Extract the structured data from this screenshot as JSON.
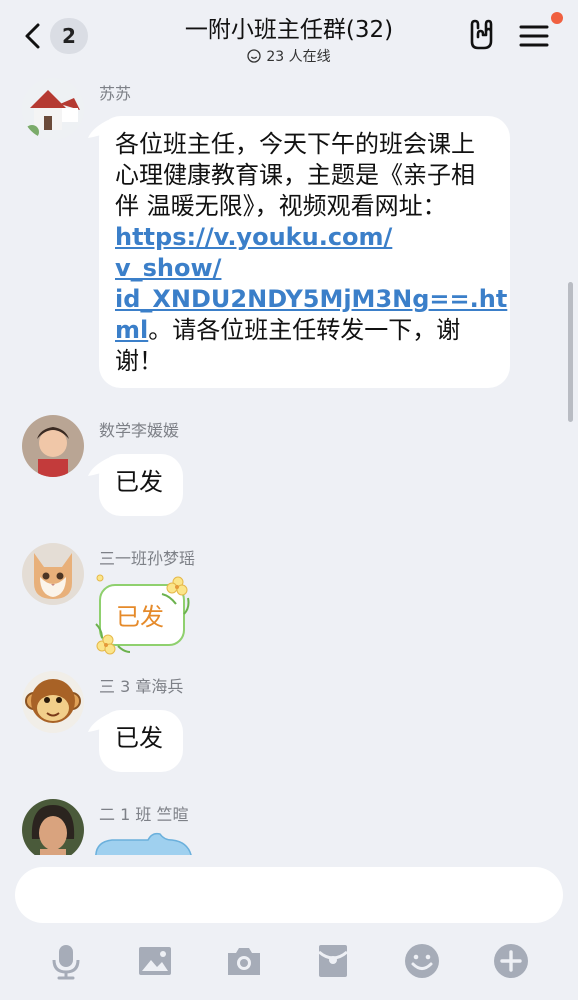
{
  "header": {
    "unread_count": "2",
    "title": "一附小班主任群(32)",
    "online_status": "23 人在线"
  },
  "messages": [
    {
      "sender": "苏苏",
      "text_before_link": "各位班主任，今天下午的班会课上心理健康教育课，主题是《亲子相伴 温暖无限》，视频观看网址：",
      "link": "https://v.youku.com/v_show/id_XNDU2NDY5MjM3Ng==.html",
      "link_line1": "https://v.youku.com/",
      "link_line2": "v_show/",
      "link_line3": "id_XNDU2NDY5MjM3Ng==.ht",
      "link_line4": "ml",
      "text_after_link": "。请各位班主任转发一下，谢谢！"
    },
    {
      "sender": "数学李媛媛",
      "text": "已发"
    },
    {
      "sender": "三一班孙梦瑶",
      "text": "已发"
    },
    {
      "sender": "三 3 章海兵",
      "text": "已发"
    },
    {
      "sender": "二 1 班 竺暄"
    }
  ],
  "composer": {
    "placeholder": ""
  },
  "toolbar": [
    "microphone-icon",
    "image-icon",
    "camera-icon",
    "red-packet-icon",
    "emoji-icon",
    "plus-icon"
  ],
  "colors": {
    "link": "#3b7fc9",
    "badge": "#f06040",
    "icon": "#a6acb8"
  }
}
